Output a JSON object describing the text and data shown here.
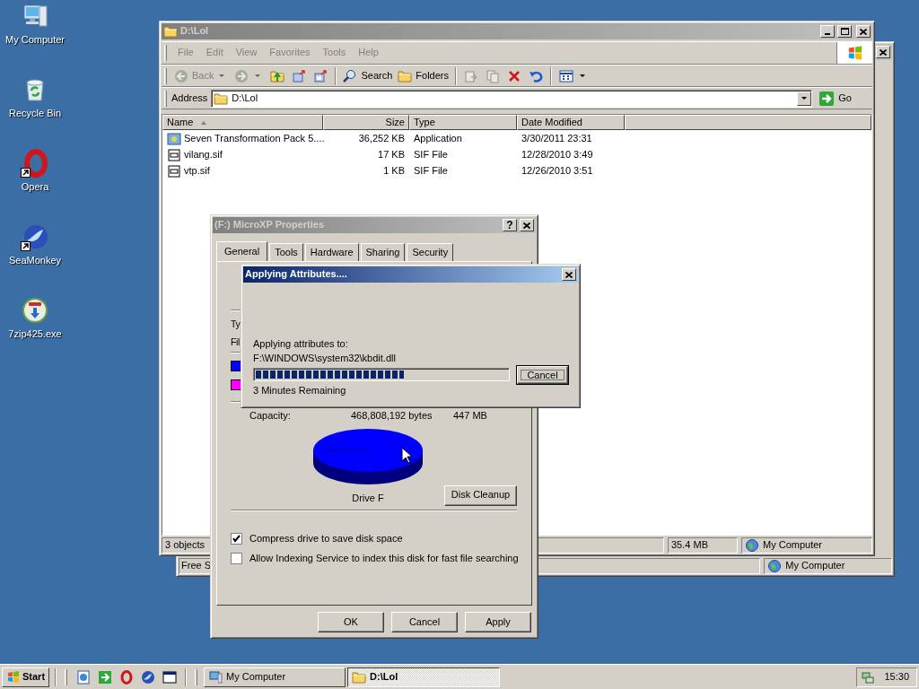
{
  "desktop_icons": [
    {
      "kind": "computer",
      "label": "My Computer",
      "shortcut": false
    },
    {
      "kind": "recycle",
      "label": "Recycle Bin",
      "shortcut": false
    },
    {
      "kind": "ring",
      "label": "Opera",
      "shortcut": true
    },
    {
      "kind": "wave",
      "label": "SeaMonkey",
      "shortcut": true
    },
    {
      "kind": "installer",
      "label": "7zip425.exe",
      "shortcut": false
    }
  ],
  "back_window": {
    "active": false,
    "status_bar": [
      "Free S",
      "My Computer"
    ]
  },
  "explorer": {
    "title": "D:\\Lol",
    "active": false,
    "menu": [
      {
        "label": "File",
        "disabled": true
      },
      {
        "label": "Edit",
        "disabled": true
      },
      {
        "label": "View",
        "disabled": true
      },
      {
        "label": "Favorites",
        "disabled": true
      },
      {
        "label": "Tools",
        "disabled": true
      },
      {
        "label": "Help",
        "disabled": true
      }
    ],
    "toolbar": [
      {
        "kind": "back",
        "label": "Back",
        "disabled": true,
        "dropdown": true
      },
      {
        "kind": "forward",
        "disabled": true,
        "dropdown": true
      },
      {
        "kind": "up",
        "disabled": false
      },
      {
        "kind": "move-to",
        "disabled": false
      },
      {
        "kind": "copy-to",
        "disabled": false
      },
      {
        "kind": "separator"
      },
      {
        "kind": "search",
        "label": "Search",
        "disabled": false
      },
      {
        "kind": "folders",
        "label": "Folders",
        "disabled": false
      },
      {
        "kind": "separator"
      },
      {
        "kind": "move",
        "disabled": true
      },
      {
        "kind": "copy",
        "disabled": true
      },
      {
        "kind": "delete",
        "disabled": false
      },
      {
        "kind": "undo",
        "disabled": false
      },
      {
        "kind": "separator"
      },
      {
        "kind": "views",
        "disabled": false,
        "dropdown": true
      }
    ],
    "address": {
      "label": "Address",
      "value": "D:\\Lol",
      "go": "Go"
    },
    "columns": [
      "Name",
      "Size",
      "Type",
      "Date Modified"
    ],
    "rows": [
      {
        "kind": "application",
        "name": "Seven Transformation Pack 5....",
        "size": "36,252 KB",
        "type": "Application",
        "date": "3/30/2011 23:31"
      },
      {
        "kind": "sif",
        "name": "vilang.sif",
        "size": "17 KB",
        "type": "SIF File",
        "date": "12/28/2010 3:49"
      },
      {
        "kind": "sif",
        "name": "vtp.sif",
        "size": "1 KB",
        "type": "SIF File",
        "date": "12/26/2010 3:51"
      }
    ],
    "status_bar": [
      "3 objects",
      "35.4 MB",
      "My Computer"
    ]
  },
  "properties": {
    "title": "(F:) MicroXP Properties",
    "active": false,
    "help": "?",
    "tabs": [
      {
        "label": "General",
        "selected": true
      },
      {
        "label": "Tools",
        "selected": false
      },
      {
        "label": "Hardware",
        "selected": false
      },
      {
        "label": "Sharing",
        "selected": false
      },
      {
        "label": "Security",
        "selected": false
      }
    ],
    "cut_labels": [
      "Ty",
      "Fil"
    ],
    "legend": [
      {
        "color": "#0000ff"
      },
      {
        "color": "#ff00ff"
      }
    ],
    "capacity": {
      "label": "Capacity:",
      "bytes": "468,808,192 bytes",
      "size": "447 MB"
    },
    "drive_label": "Drive F",
    "disk_cleanup": "Disk Cleanup",
    "options": [
      {
        "label": "Compress drive to save disk space",
        "checked": true
      },
      {
        "label": "Allow Indexing Service to index this disk for fast file searching",
        "checked": false
      }
    ],
    "buttons": [
      "OK",
      "Cancel",
      "Apply"
    ]
  },
  "progress_dialog": {
    "title": "Applying Attributes....",
    "active": true,
    "label": "Applying attributes to:",
    "path": "F:\\WINDOWS\\system32\\kbdit.dll",
    "level": 0.59,
    "remaining": "3 Minutes Remaining",
    "cancel": {
      "label": "Cancel",
      "focused": true
    }
  },
  "taskbar": {
    "start": "Start",
    "quick_launch": [
      {
        "kind": "browser"
      },
      {
        "kind": "switch"
      },
      {
        "kind": "ring"
      },
      {
        "kind": "wave"
      },
      {
        "kind": "window"
      }
    ],
    "tasks": [
      {
        "label": "My Computer",
        "kind": "computer",
        "selected": false
      },
      {
        "label": "D:\\Lol",
        "kind": "folder",
        "selected": true
      }
    ],
    "clock": "15:30"
  }
}
